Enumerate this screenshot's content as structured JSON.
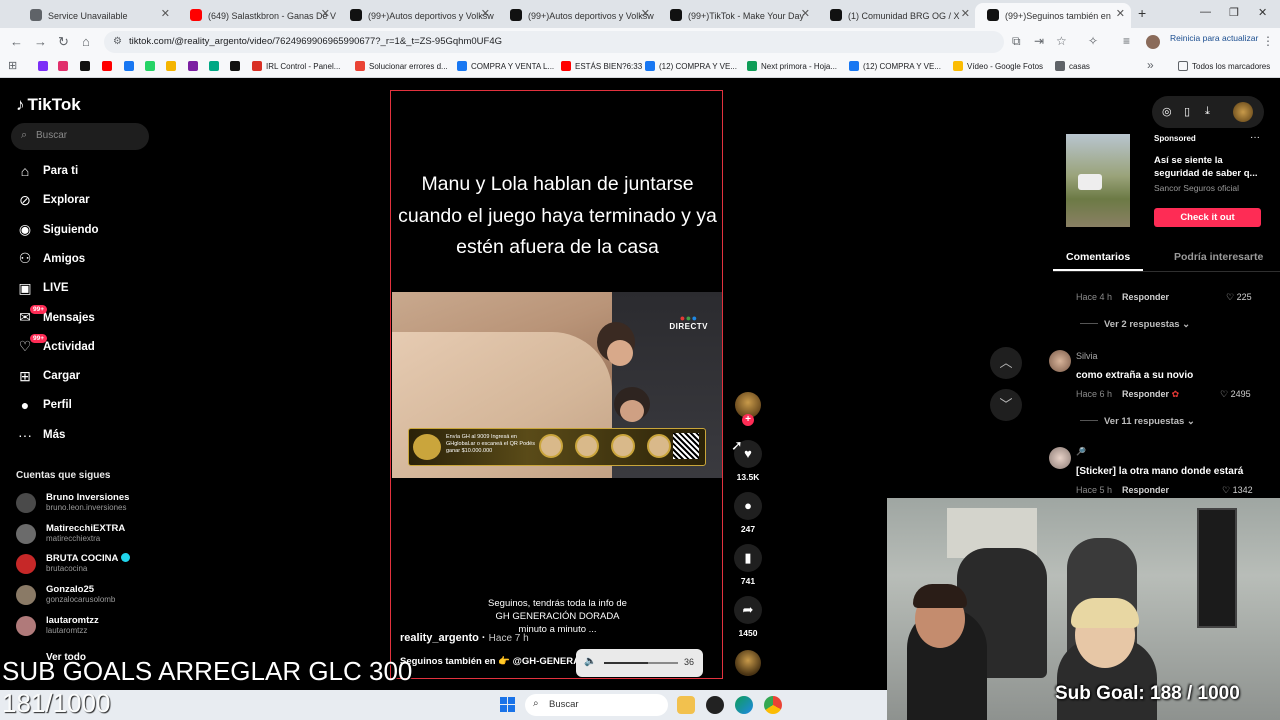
{
  "browser": {
    "tabs": [
      {
        "title": "Service Unavailable",
        "color": "#5f6368"
      },
      {
        "title": "(649) Salastkbron - Ganas De V",
        "color": "#ff0000"
      },
      {
        "title": "(99+)Autos deportivos y Volksw",
        "color": "#111111"
      },
      {
        "title": "(99+)Autos deportivos y Volksw",
        "color": "#111111"
      },
      {
        "title": "(99+)TikTok - Make Your Day",
        "color": "#111111"
      },
      {
        "title": "(1) Comunidad BRG OG / X",
        "color": "#111111"
      },
      {
        "title": "(99+)Seguinos también en",
        "color": "#111111"
      }
    ],
    "new_tab": "+",
    "window_controls": {
      "minimize": "—",
      "maximize": "❐",
      "close": "✕"
    },
    "url": "tiktok.com/@reality_argento/video/7624969906965990677?_r=1&_t=ZS-95Gqhm0UF4G",
    "restart_label": "Reinicia para actualizar",
    "bookmarks": [
      {
        "label": "",
        "color": "#7b2ff7"
      },
      {
        "label": "",
        "color": "#e1306c"
      },
      {
        "label": "",
        "color": "#111111"
      },
      {
        "label": "",
        "color": "#ff0000"
      },
      {
        "label": "",
        "color": "#1877f2"
      },
      {
        "label": "",
        "color": "#25d366"
      },
      {
        "label": "",
        "color": "#f4b400"
      },
      {
        "label": "",
        "color": "#7b1fa2"
      },
      {
        "label": "",
        "color": "#00a884"
      },
      {
        "label": "",
        "color": "#111111"
      },
      {
        "label": "IRL Control - Panel...",
        "color": "#d93025"
      },
      {
        "label": "Solucionar errores d...",
        "color": "#ea4335"
      },
      {
        "label": "COMPRA Y VENTA L...",
        "color": "#1877f2"
      },
      {
        "label": "ESTÁS BIEN?6:33",
        "color": "#ff0000"
      },
      {
        "label": "(12) COMPRA Y VE...",
        "color": "#1877f2"
      },
      {
        "label": "Next primora - Hoja...",
        "color": "#0f9d58"
      },
      {
        "label": "(12) COMPRA Y VE...",
        "color": "#1877f2"
      },
      {
        "label": "Vídeo - Google Fotos",
        "color": "#fbbc04"
      },
      {
        "label": "casas",
        "color": "#5f6368"
      }
    ],
    "bookmarks_more": "»",
    "all_bookmarks": "Todos los marcadores"
  },
  "tiktok": {
    "logo": "TikTok",
    "search_placeholder": "Buscar",
    "nav": [
      {
        "label": "Para ti",
        "icon": "home-icon",
        "glyph": "⌂"
      },
      {
        "label": "Explorar",
        "icon": "compass-icon",
        "glyph": "⊘"
      },
      {
        "label": "Siguiendo",
        "icon": "following-icon",
        "glyph": "◉"
      },
      {
        "label": "Amigos",
        "icon": "friends-icon",
        "glyph": "⚇"
      },
      {
        "label": "LIVE",
        "icon": "live-icon",
        "glyph": "▣"
      },
      {
        "label": "Mensajes",
        "icon": "messages-icon",
        "glyph": "✉",
        "badge": "99+"
      },
      {
        "label": "Actividad",
        "icon": "activity-icon",
        "glyph": "♡",
        "badge": "99+"
      },
      {
        "label": "Cargar",
        "icon": "upload-icon",
        "glyph": "⊞"
      },
      {
        "label": "Perfil",
        "icon": "profile-icon",
        "glyph": "●"
      },
      {
        "label": "Más",
        "icon": "more-icon",
        "glyph": "···"
      }
    ],
    "following_title": "Cuentas que sigues",
    "following": [
      {
        "name": "Bruno Inversiones",
        "handle": "bruno.leon.inversiones",
        "color": "#4a4a4a",
        "verified": false
      },
      {
        "name": "MatirecchiEXTRA",
        "handle": "matirecchiextra",
        "color": "#6b6b6b",
        "verified": false
      },
      {
        "name": "BRUTA COCINA",
        "handle": "brutacocina",
        "color": "#c62828",
        "verified": true
      },
      {
        "name": "Gonzalo25",
        "handle": "gonzalocarusolomb",
        "color": "#8a7a66",
        "verified": false
      },
      {
        "name": "lautaromtzz",
        "handle": "lautaromtzz",
        "color": "#b07a7a",
        "verified": false
      }
    ],
    "see_all": "Ver todo"
  },
  "video": {
    "caption": "Manu y Lola hablan de juntarse cuando el juego haya terminado y ya estén afuera de la casa",
    "watermark": "DIRECTV",
    "banner_text": "Envía GH al 9009 Ingresá en GHglobal.ar o escaneá el QR Podés ganar $10.000.000",
    "subtitle_lines": [
      "Seguinos, tendrás toda la info de",
      "GH GENERACIÓN DORADA",
      "minuto a minuto ..."
    ],
    "author": "reality_argento",
    "time": "Hace 7 h",
    "description": "Seguinos también en 👉 @GH-GENERAC",
    "description_tail": "s",
    "volume": {
      "level": 0.6,
      "value": "36"
    }
  },
  "actions": [
    {
      "icon": "heart-icon",
      "glyph": "♥",
      "count": "13.5K"
    },
    {
      "icon": "comment-icon",
      "glyph": "●",
      "count": "247"
    },
    {
      "icon": "bookmark-icon",
      "glyph": "▮",
      "count": "741"
    },
    {
      "icon": "share-icon",
      "glyph": "➦",
      "count": "1450"
    }
  ],
  "nav_arrows": {
    "up": "︿",
    "down": "﹀"
  },
  "ad": {
    "sponsored": "Sponsored",
    "title": "Así se siente la seguridad de saber q...",
    "brand": "Sancor Seguros oficial",
    "cta": "Check it out",
    "more": "···"
  },
  "comments_panel": {
    "tab_active": "Comentarios",
    "tab_other": "Podría interesarte",
    "items": [
      {
        "type": "meta",
        "time": "Hace 4 h",
        "reply": "Responder",
        "likes": "225"
      },
      {
        "type": "replies",
        "label": "Ver 2 respuestas"
      },
      {
        "type": "comment",
        "user": "Silvia",
        "text": "como extraña a su novio",
        "time": "Hace 6 h",
        "reply": "Responder",
        "likes": "2495"
      },
      {
        "type": "replies",
        "label": "Ver 11 respuestas"
      },
      {
        "type": "comment",
        "user": "🔎",
        "text": "[Sticker] la otra mano donde estará",
        "time": "Hace 5 h",
        "reply": "Responder",
        "likes": "1342"
      }
    ]
  },
  "stream": {
    "sub_goals_text": "SUB GOALS ARREGLAR GLC 300",
    "sub_count": "181/1000",
    "cam_sub_goal": "Sub Goal: 188 / 1000"
  },
  "taskbar": {
    "search_placeholder": "Buscar"
  }
}
